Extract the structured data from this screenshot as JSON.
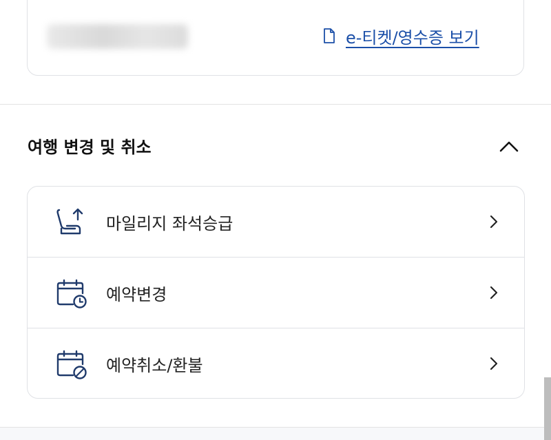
{
  "ticket_card": {
    "eticket_link_label": "e-티켓/영수증 보기"
  },
  "trip_change": {
    "title": "여행 변경 및 취소",
    "items": [
      {
        "label": "마일리지 좌석승급",
        "icon": "seat-upgrade-icon"
      },
      {
        "label": "예약변경",
        "icon": "calendar-clock-icon"
      },
      {
        "label": "예약취소/환불",
        "icon": "calendar-cancel-icon"
      }
    ]
  },
  "colors": {
    "icon_navy": "#1f3a6b",
    "link_blue": "#1b4fa8",
    "border": "#dfe1e5"
  }
}
